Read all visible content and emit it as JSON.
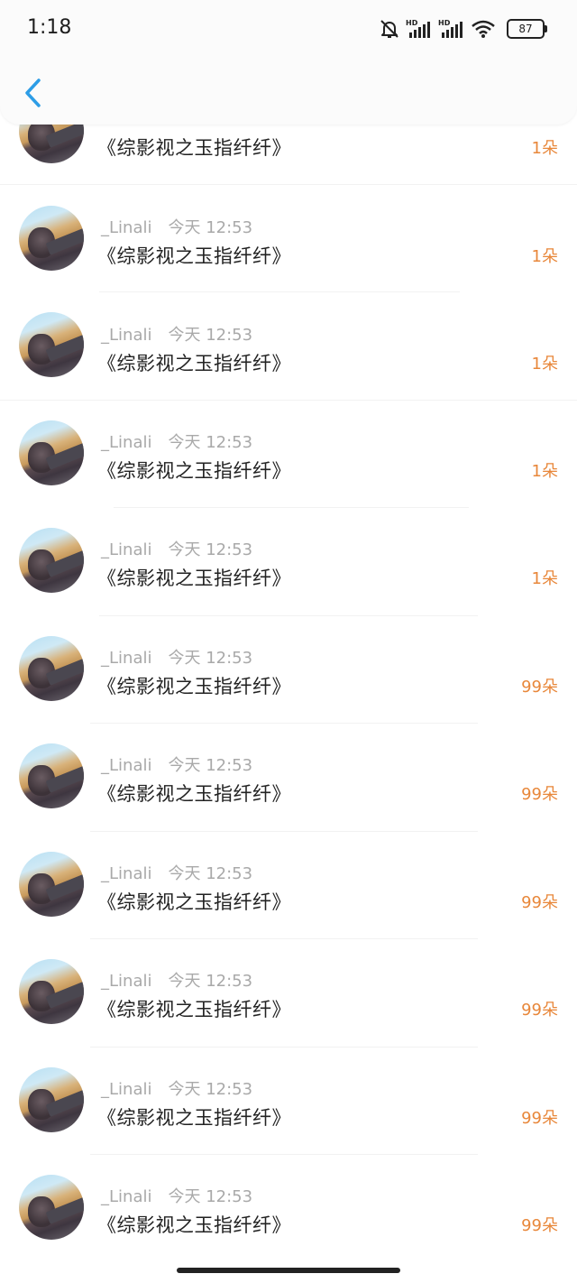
{
  "status_bar": {
    "time": "1:18",
    "battery": "87"
  },
  "nav": {
    "back_icon": "chevron-left-icon"
  },
  "partial_row": {
    "title": "《综影视之玉指纤纤》",
    "count": "1朵"
  },
  "rows": [
    {
      "name": "_Linali",
      "time": "今天 12:53",
      "title": "《综影视之玉指纤纤》",
      "count": "1朵"
    },
    {
      "name": "_Linali",
      "time": "今天 12:53",
      "title": "《综影视之玉指纤纤》",
      "count": "1朵"
    },
    {
      "name": "_Linali",
      "time": "今天 12:53",
      "title": "《综影视之玉指纤纤》",
      "count": "1朵"
    },
    {
      "name": "_Linali",
      "time": "今天 12:53",
      "title": "《综影视之玉指纤纤》",
      "count": "1朵"
    },
    {
      "name": "_Linali",
      "time": "今天 12:53",
      "title": "《综影视之玉指纤纤》",
      "count": "99朵"
    },
    {
      "name": "_Linali",
      "time": "今天 12:53",
      "title": "《综影视之玉指纤纤》",
      "count": "99朵"
    },
    {
      "name": "_Linali",
      "time": "今天 12:53",
      "title": "《综影视之玉指纤纤》",
      "count": "99朵"
    },
    {
      "name": "_Linali",
      "time": "今天 12:53",
      "title": "《综影视之玉指纤纤》",
      "count": "99朵"
    },
    {
      "name": "_Linali",
      "time": "今天 12:53",
      "title": "《综影视之玉指纤纤》",
      "count": "99朵"
    },
    {
      "name": "_Linali",
      "time": "今天 12:53",
      "title": "《综影视之玉指纤纤》",
      "count": "99朵"
    }
  ],
  "colors": {
    "accent_count": "#e8873a",
    "back_arrow": "#2d9de6"
  }
}
